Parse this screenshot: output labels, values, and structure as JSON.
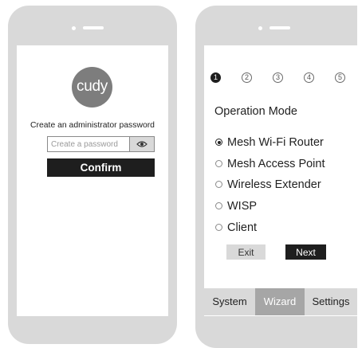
{
  "login": {
    "logo_text": "cudy",
    "prompt": "Create an administrator password",
    "password_placeholder": "Create a password",
    "password_value": "",
    "show_password_icon": "eye-icon",
    "confirm_label": "Confirm"
  },
  "wizard": {
    "steps": [
      "1",
      "2",
      "3",
      "4",
      "5"
    ],
    "active_step": "1",
    "title": "Operation Mode",
    "options": [
      {
        "label": "Mesh Wi-Fi Router",
        "selected": true
      },
      {
        "label": "Mesh Access Point",
        "selected": false
      },
      {
        "label": "Wireless Extender",
        "selected": false
      },
      {
        "label": "WISP",
        "selected": false
      },
      {
        "label": "Client",
        "selected": false
      }
    ],
    "exit_label": "Exit",
    "next_label": "Next",
    "tabs": [
      {
        "label": "System",
        "active": false
      },
      {
        "label": "Wizard",
        "active": true
      },
      {
        "label": "Settings",
        "active": false
      }
    ]
  },
  "colors": {
    "phone_body": "#d9d9d9",
    "primary_button": "#1e1e1e",
    "logo_bg": "#7d7d7d",
    "active_tab": "#a6a6a6"
  }
}
